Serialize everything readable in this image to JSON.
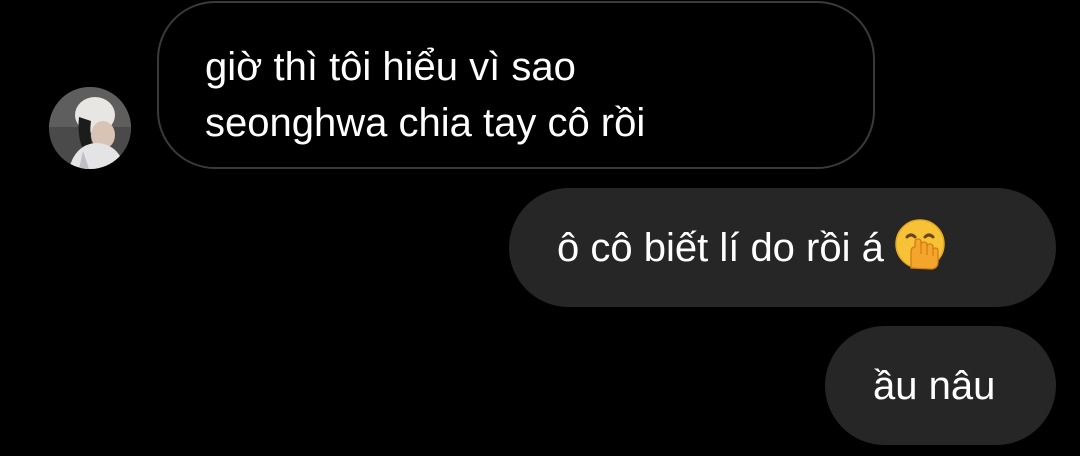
{
  "conversation": {
    "incoming": {
      "lines": [
        "giờ thì tôi hiểu vì sao",
        "seonghwa chia tay cô rồi"
      ]
    },
    "outgoing": [
      {
        "text": "ô cô biết lí do rồi á",
        "emoji": "hand-over-mouth-emoji"
      },
      {
        "text": "ầu nâu"
      }
    ]
  },
  "colors": {
    "background": "#000000",
    "incoming_border": "#3a3a3a",
    "outgoing_bubble": "#262626",
    "text": "#ffffff"
  }
}
